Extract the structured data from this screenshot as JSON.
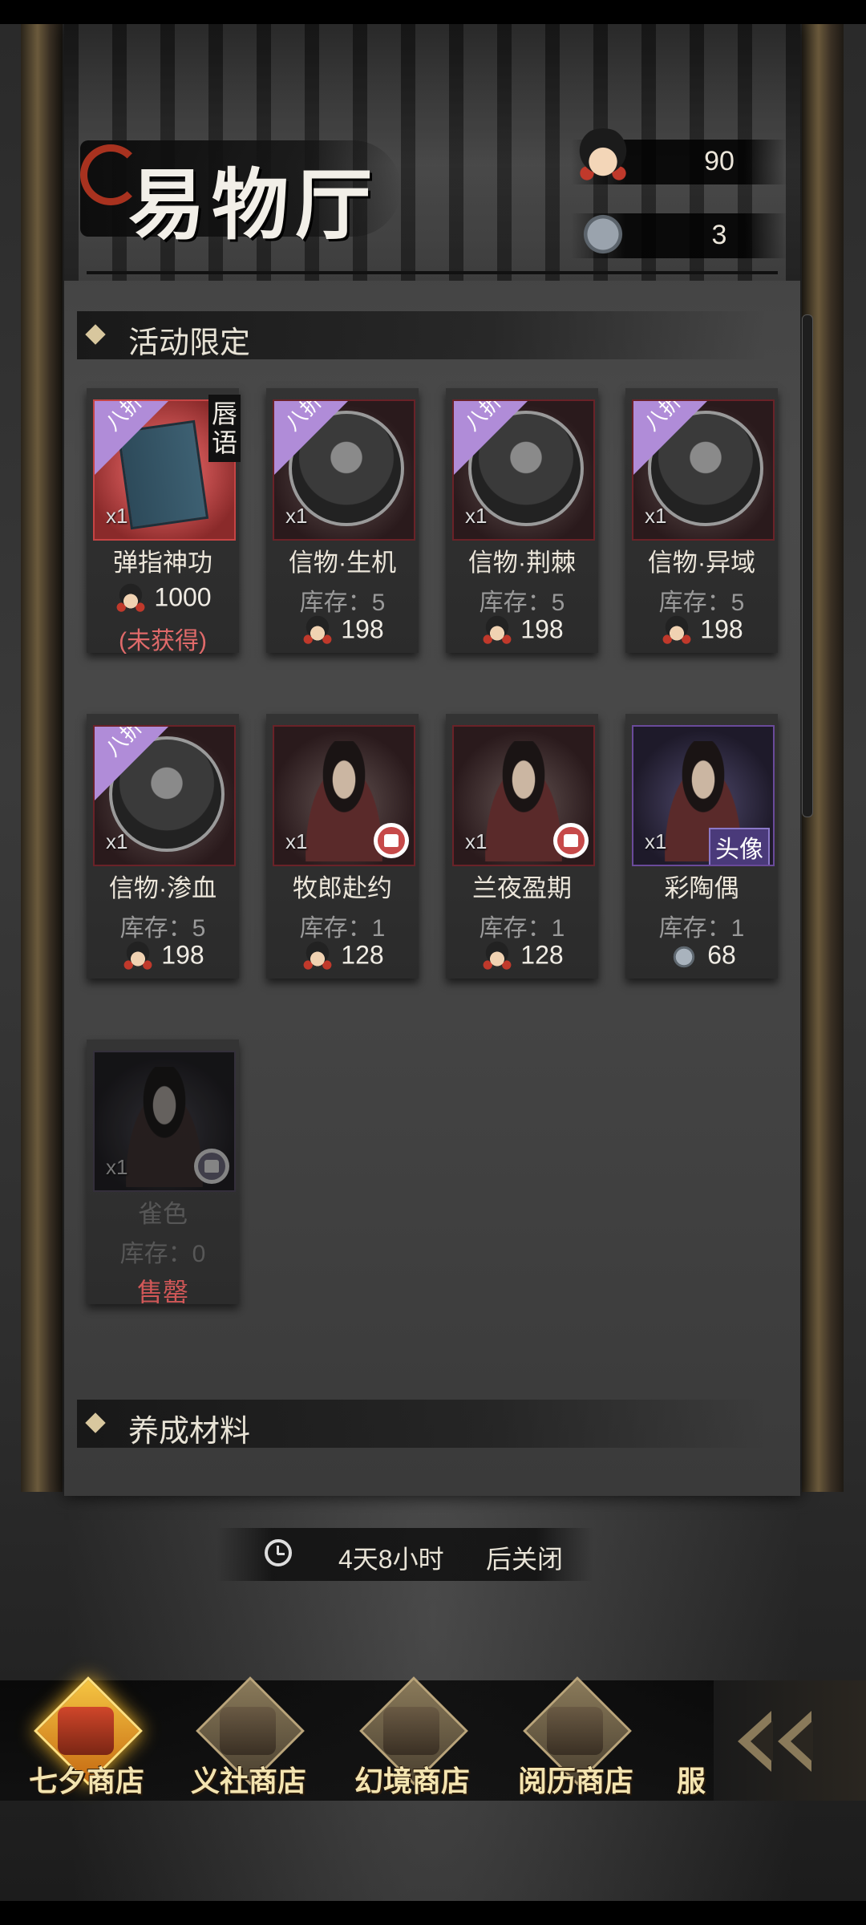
{
  "title": "易物厅",
  "currencies": [
    {
      "icon": "ceramic-doll-icon",
      "value": "90"
    },
    {
      "icon": "mask-icon",
      "value": "3"
    }
  ],
  "sections": [
    {
      "label": "活动限定"
    },
    {
      "label": "养成材料"
    }
  ],
  "items": [
    {
      "name": "弹指神功",
      "qty": "x1",
      "discount": "八折",
      "tag": "唇语",
      "price": "1000",
      "currency_icon": "ceramic-doll-icon",
      "status": "(未获得)"
    },
    {
      "name": "信物·生机",
      "qty": "x1",
      "discount": "八折",
      "stock": "库存：5",
      "price": "198",
      "currency_icon": "ceramic-doll-icon"
    },
    {
      "name": "信物·荆棘",
      "qty": "x1",
      "discount": "八折",
      "stock": "库存：5",
      "price": "198",
      "currency_icon": "ceramic-doll-icon"
    },
    {
      "name": "信物·异域",
      "qty": "x1",
      "discount": "八折",
      "stock": "库存：5",
      "price": "198",
      "currency_icon": "ceramic-doll-icon"
    },
    {
      "name": "信物·渗血",
      "qty": "x1",
      "discount": "八折",
      "stock": "库存：5",
      "price": "198",
      "currency_icon": "ceramic-doll-icon"
    },
    {
      "name": "牧郎赴约",
      "qty": "x1",
      "stock": "库存：1",
      "price": "128",
      "currency_icon": "ceramic-doll-icon",
      "badge": "outfit-icon"
    },
    {
      "name": "兰夜盈期",
      "qty": "x1",
      "stock": "库存：1",
      "price": "128",
      "currency_icon": "ceramic-doll-icon",
      "badge": "outfit-icon"
    },
    {
      "name": "彩陶偶",
      "qty": "x1",
      "stock": "库存：1",
      "price": "68",
      "currency_icon": "mask-icon",
      "tag": "头像"
    },
    {
      "name": "雀色",
      "qty": "x1",
      "stock": "库存：0",
      "status": "售罄",
      "badge": "outfit-icon"
    }
  ],
  "timer": {
    "remaining": "4天8小时",
    "suffix": "后关闭"
  },
  "tabs": [
    {
      "label": "七夕商店",
      "active": true
    },
    {
      "label": "义社商店"
    },
    {
      "label": "幻境商店"
    },
    {
      "label": "阅历商店"
    },
    {
      "label": "服"
    }
  ]
}
